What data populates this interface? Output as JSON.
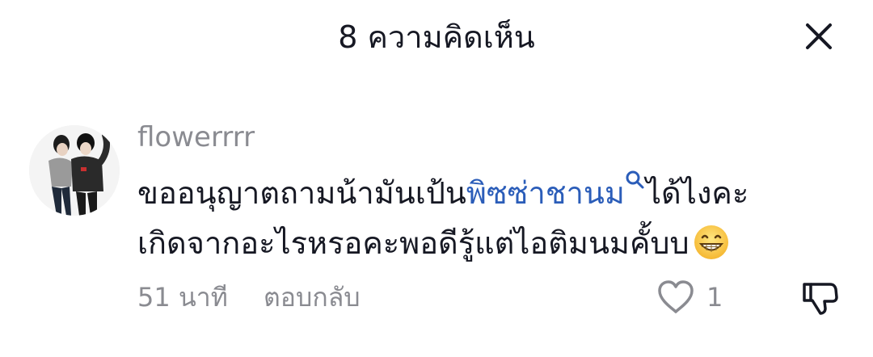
{
  "header": {
    "title": "8 ความคิดเห็น",
    "close_icon": "close-icon"
  },
  "comment": {
    "username": "flowerrrr",
    "line1_before": "ขออนุญาตถามน้ามันเป้น",
    "line1_link": "พิซซ่าชานม",
    "line1_after": "ได้ไงคะ",
    "line2": "เกิดจากอะไรหรอคะพอดีรู้แต่ไอติมนมคั้บบ",
    "emoji": "grinning-face-icon",
    "time": "51 นาที",
    "reply_label": "ตอบกลับ",
    "like_count": "1"
  },
  "colors": {
    "text_primary": "#161823",
    "text_secondary": "#8a8b91",
    "link": "#2b5db9"
  }
}
